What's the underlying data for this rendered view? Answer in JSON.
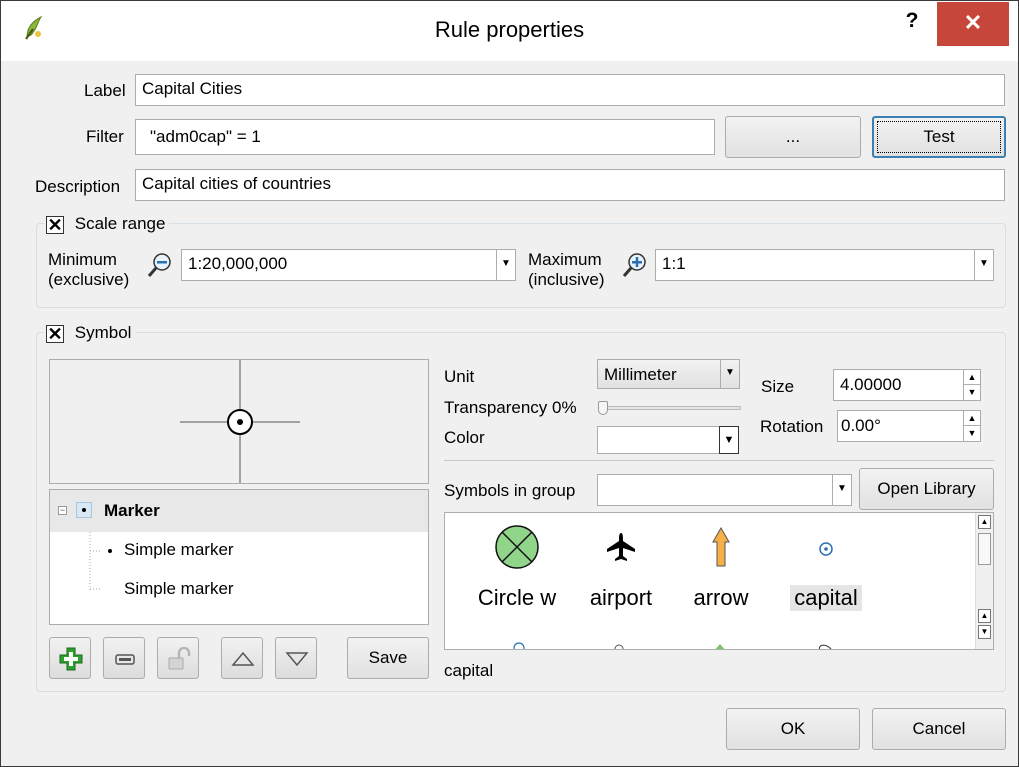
{
  "window": {
    "title": "Rule properties",
    "help_glyph": "?",
    "close_glyph": "✕"
  },
  "form": {
    "label_caption": "Label",
    "label_value": "Capital Cities",
    "filter_caption": "Filter",
    "filter_value": "\"adm0cap\"  =  1",
    "filter_expr_button": "...",
    "test_button": "Test",
    "description_caption": "Description",
    "description_value": "Capital cities of countries"
  },
  "scale_range": {
    "title": "Scale range",
    "checked": true,
    "check_glyph": "✕",
    "min_label_1": "Minimum",
    "min_label_2": "(exclusive)",
    "min_value": "1:20,000,000",
    "max_label_1": "Maximum",
    "max_label_2": "(inclusive)",
    "max_value": "1:1"
  },
  "symbol": {
    "title": "Symbol",
    "checked": true,
    "check_glyph": "✕",
    "tree": [
      {
        "label": "Marker",
        "bold": true
      },
      {
        "label": "Simple marker"
      },
      {
        "label": "Simple marker"
      }
    ],
    "toolbar_icons": [
      "add-layer-icon",
      "remove-layer-icon",
      "lock-icon",
      "move-up-icon",
      "move-down-icon"
    ],
    "save_button": "Save",
    "unit_label": "Unit",
    "unit_value": "Millimeter",
    "transparency_label": "Transparency 0%",
    "transparency_percent": 0,
    "color_label": "Color",
    "color_value": "#ffffff",
    "size_label": "Size",
    "size_value": "4.00000",
    "rotation_label": "Rotation",
    "rotation_value": "0.00°",
    "symbols_in_group_label": "Symbols in group",
    "symbols_in_group_value": "",
    "open_library_button": "Open Library",
    "library": [
      {
        "name": "Circle w",
        "icon": "circle-cross-icon"
      },
      {
        "name": "airport",
        "icon": "airplane-icon"
      },
      {
        "name": "arrow",
        "icon": "arrow-up-icon"
      },
      {
        "name": "capital",
        "icon": "capital-icon",
        "selected": true
      }
    ],
    "selected_symbol_name": "capital"
  },
  "footer": {
    "ok_button": "OK",
    "cancel_button": "Cancel"
  },
  "colors": {
    "close_red": "#c7463a",
    "symbol_green": "#90d58a",
    "arrow_orange": "#f5b048",
    "selection_blue": "#3c7fb1"
  }
}
